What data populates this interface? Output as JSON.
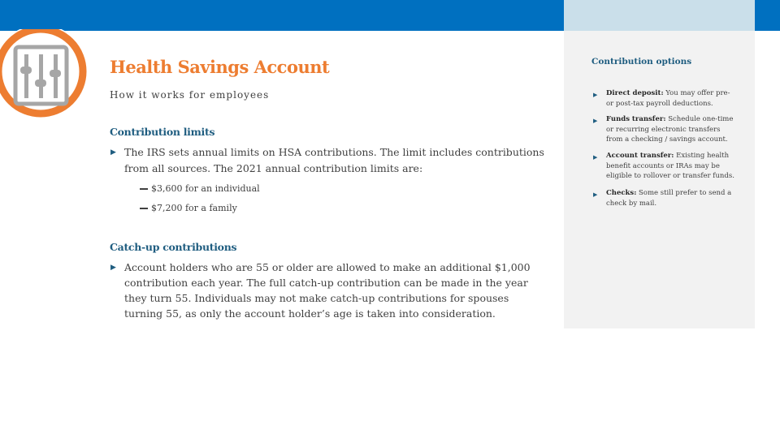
{
  "header": {
    "title": "Health Savings Account",
    "subtitle": "How it works for employees",
    "icon": "sliders-icon"
  },
  "colors": {
    "topbar": "#0070c0",
    "topbar_light": "#cadfea",
    "accent_orange": "#ed7d31",
    "heading_blue": "#1f5d80",
    "panel_bg": "#f2f2f2",
    "icon_gray": "#a6a6a6"
  },
  "sections": [
    {
      "heading": "Contribution limits",
      "bullet": "The IRS sets annual limits on HSA contributions. The limit includes contributions from all sources. The 2021 annual contribution limits are:",
      "subitems": [
        "$3,600 for an individual",
        "$7,200 for a family"
      ]
    },
    {
      "heading": "Catch-up contributions",
      "bullet": "Account holders who are 55 or older are allowed to make an additional $1,000 contribution each year. The full catch-up contribution can be made in the year they turn 55. Individuals may not make catch-up contributions for spouses turning 55, as only the account holder’s age is taken into consideration."
    }
  ],
  "sidebar": {
    "title": "Contribution options",
    "items": [
      {
        "label": "Direct deposit:",
        "text": "You may offer pre- or post-tax payroll deductions."
      },
      {
        "label": "Funds transfer:",
        "text": "Schedule one-time or recurring electronic transfers from a checking / savings account."
      },
      {
        "label": "Account transfer:",
        "text": "Existing health benefit accounts or IRAs may be eligible to rollover or transfer funds."
      },
      {
        "label": "Checks:",
        "text": "Some still prefer to send a check by mail."
      }
    ]
  }
}
